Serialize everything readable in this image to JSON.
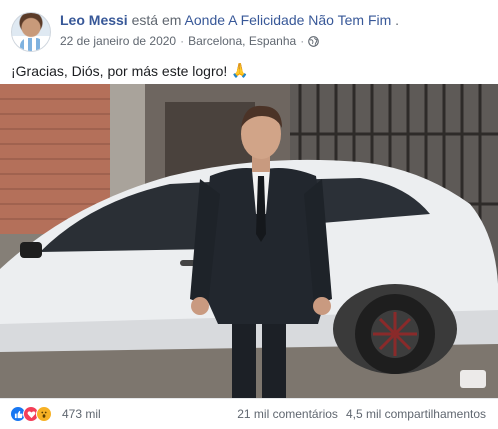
{
  "post": {
    "author": "Leo Messi",
    "action_text": "está em",
    "place": "Aonde A Felicidade Não Tem Fim",
    "place_suffix": ".",
    "date": "22 de janeiro de 2020",
    "separator": "·",
    "location": "Barcelona, Espanha",
    "privacy_icon": "globe-icon",
    "text": "¡Gracias, Diós, por más este logro!",
    "text_emoji": "🙏"
  },
  "footer": {
    "reactions": [
      "like-icon",
      "love-icon",
      "wow-icon"
    ],
    "reaction_count": "473 mil",
    "comments": "21 mil comentários",
    "shares": "4,5 mil compartilhamentos"
  },
  "colors": {
    "link_blue": "#385898",
    "secondary_text": "#606770",
    "like_blue": "#1877f2",
    "love_red": "#f33e58",
    "wow_yellow": "#f7b125"
  }
}
